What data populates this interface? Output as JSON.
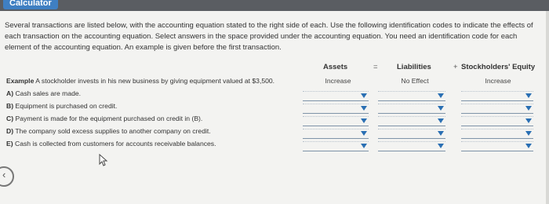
{
  "window": {
    "calculator_label": "Calculator"
  },
  "instructions": "Several transactions are listed below, with the accounting equation stated to the right side of each. Use the following identification codes to indicate the effects of each transaction on the accounting equation. Select answers in the space provided under the accounting equation. You need an identification code for each element of the accounting equation. An example is given before the first transaction.",
  "headers": {
    "assets": "Assets",
    "equals": "=",
    "liabilities": "Liabilities",
    "plus": "+",
    "equity": "Stockholders' Equity"
  },
  "example": {
    "prefix": "Example",
    "text": "A stockholder invests in his new business by giving equipment valued at $3,500.",
    "assets": "Increase",
    "liabilities": "No Effect",
    "equity": "Increase"
  },
  "transactions": [
    {
      "letter": "A)",
      "text": "Cash sales are made."
    },
    {
      "letter": "B)",
      "text": "Equipment is purchased on credit."
    },
    {
      "letter": "C)",
      "text": "Payment is made for the equipment purchased on credit in (B)."
    },
    {
      "letter": "D)",
      "text": "The company sold excess supplies to another company on credit."
    },
    {
      "letter": "E)",
      "text": "Cash is collected from customers for accounts receivable balances."
    }
  ],
  "colors": {
    "accent": "#2a6fb3",
    "topbar": "#5a5d62",
    "background": "#f3f3f1"
  }
}
